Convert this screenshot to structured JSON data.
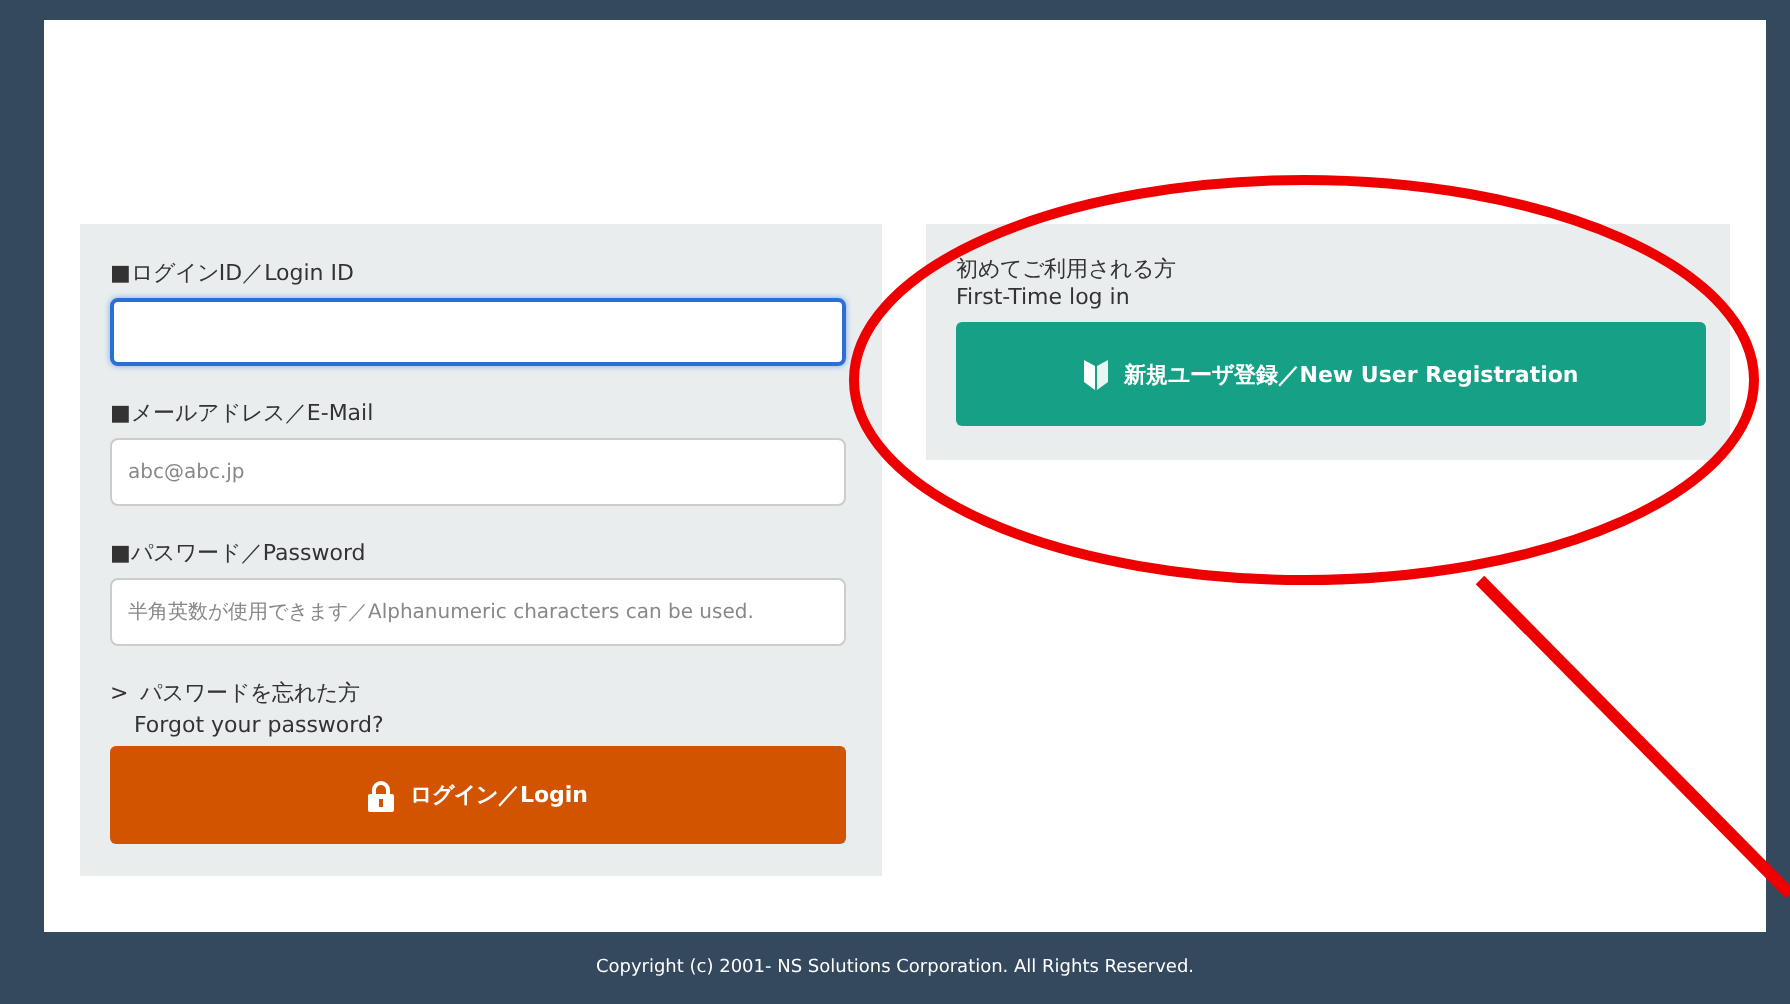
{
  "login_panel": {
    "fields": [
      {
        "label": "■ログインID／Login ID",
        "focused": true
      },
      {
        "label": "■メールアドレス／E-Mail",
        "placeholder": "abc@abc.jp",
        "focused": false
      },
      {
        "label": "■パスワード／Password",
        "placeholder": "半角英数が使用できます／Alphanumeric characters can be used.",
        "focused": false
      }
    ],
    "forgot_link": {
      "marker": ">",
      "text_ja": "パスワードを忘れた方",
      "text_en": "Forgot your password?"
    },
    "login_button": "ログイン／Login"
  },
  "register_panel": {
    "heading_ja": "初めてご利用される方",
    "heading_en": "First-Time log in",
    "register_button": "新規ユーザ登録／New User Registration"
  },
  "footer": "Copyright (c) 2001- NS Solutions Corporation. All Rights Reserved."
}
